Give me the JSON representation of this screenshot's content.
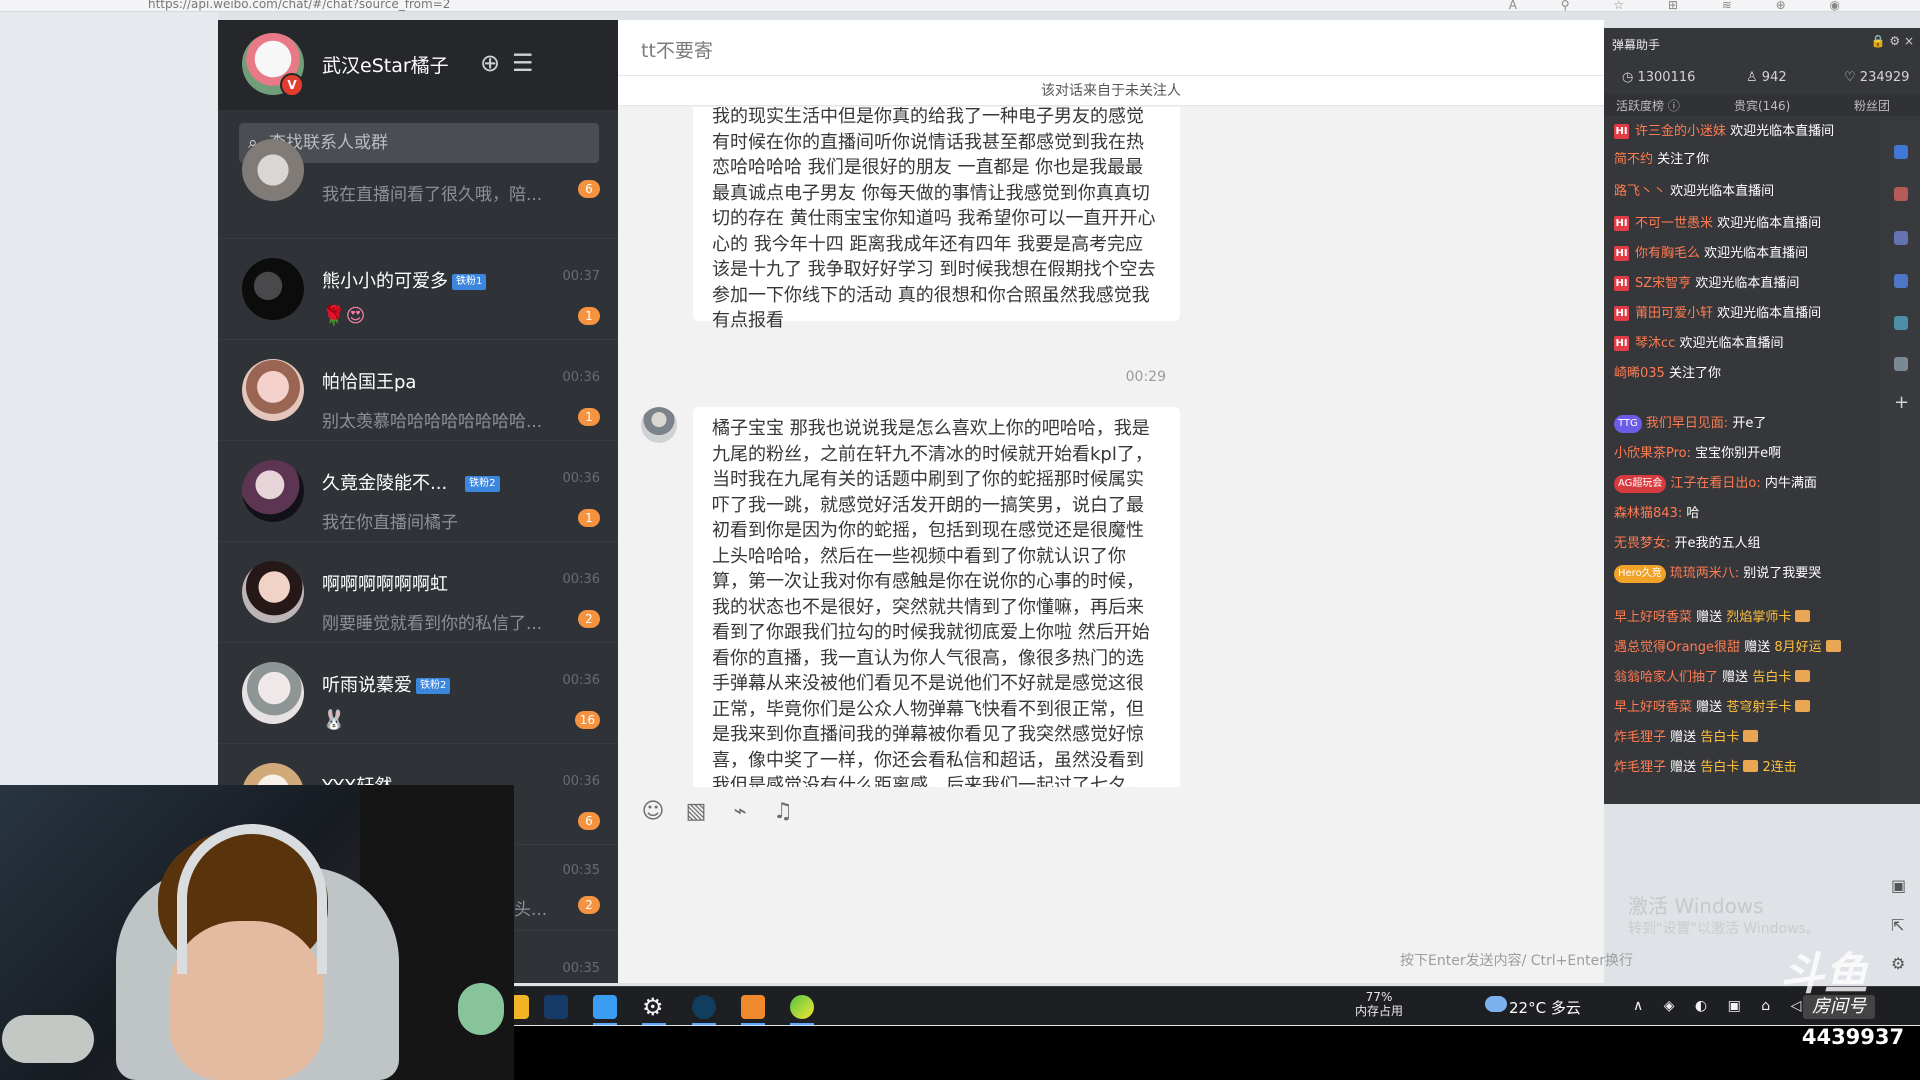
{
  "browser": {
    "url": "https://api.weibo.com/chat/#/chat?source_from=2"
  },
  "sidebar": {
    "username": "武汉eStar橘子",
    "search_placeholder": "查找联系人或群",
    "contacts": [
      {
        "name": "",
        "time": "",
        "message": "我在直播间看了很久哦，陪...",
        "badge": "6",
        "tag": "",
        "emoji": ""
      },
      {
        "name": "熊小小的可爱多",
        "time": "00:37",
        "message": "",
        "badge": "1",
        "tag": "铁粉1",
        "emoji": "🌹😍"
      },
      {
        "name": "帕恰国王pa",
        "time": "00:36",
        "message": "别太羡慕哈哈哈哈哈哈哈哈...",
        "badge": "1",
        "tag": "",
        "emoji": ""
      },
      {
        "name": "久竟金陵能不...",
        "time": "00:36",
        "message": "我在你直播间橘子",
        "badge": "1",
        "tag": "铁粉2",
        "emoji": ""
      },
      {
        "name": "啊啊啊啊啊啊虹",
        "time": "00:36",
        "message": "刚要睡觉就看到你的私信了...",
        "badge": "2",
        "tag": "",
        "emoji": ""
      },
      {
        "name": "听雨说蓁爱",
        "time": "00:36",
        "message": "",
        "badge": "16",
        "tag": "铁粉2",
        "emoji": "🐰"
      },
      {
        "name": "YYX轩然",
        "time": "00:36",
        "message": "",
        "badge": "6",
        "tag": "",
        "emoji": ""
      },
      {
        "name": "",
        "time": "00:35",
        "message": "头...",
        "badge": "2",
        "tag": "",
        "emoji": ""
      },
      {
        "name": "",
        "time": "00:35",
        "message": "",
        "badge": "",
        "tag": "",
        "emoji": ""
      }
    ]
  },
  "chat": {
    "title": "tt不要寄",
    "notice": "该对话来自于未关注人",
    "timestamp": "00:29",
    "message1": "我的现实生活中但是你真的给我了一种电子男友的感觉 有时候在你的直播间听你说情话我甚至都感觉到我在热恋哈哈哈哈 我们是很好的朋友 一直都是 你也是我最最最真诚点电子男友 你每天做的事情让我感觉到你真真切切的存在 黄仕雨宝宝你知道吗 我希望你可以一直开开心心的 我今年十四 距离我成年还有四年 我要是高考完应该是十九了 我争取好好学习 到时候我想在假期找个空去参加一下你线下的活动 真的很想和你合照虽然我感觉我有点报看",
    "message2": "橘子宝宝 那我也说说我是怎么喜欢上你的吧哈哈，我是九尾的粉丝，之前在轩九不清冰的时候就开始看kpl了，当时我在九尾有关的话题中刷到了你的蛇摇那时候属实吓了我一跳，就感觉好活发开朗的一搞笑男，说白了最初看到你是因为你的蛇摇，包括到现在感觉还是很魔性上头哈哈哈，然后在一些视频中看到了你就认识了你算，第一次让我对你有感触是你在说你的心事的时候，我的状态也不是很好，突然就共情到了你懂嘛，再后来看到了你跟我们拉勾的时候我就彻底爱上你啦 然后开始看你的直播，我一直认为你人气很高，像很多热门的选手弹幕从来没被他们看见不是说他们不好就是感觉这很正常，毕竟你们是公众人物弹幕飞快看不到很正常，但是我来到你直播间我的弹幕被你看见了我突然感觉好惊喜，像中奖了一样，你还会看私信和超话，虽然没看到我但是感觉没有什么距离感，后来我们一起过了七夕，你拿着贺卡和玫瑰花给我表白哈哈哈，突然get到了电子男友哈哈哈，感觉在被捧了爱着，然",
    "input_hint": "按下Enter发送内容/ Ctrl+Enter换行",
    "toolbar": {
      "emoji_icon": "smile-icon",
      "image_icon": "image-icon",
      "attach_icon": "paperclip-icon",
      "bell_icon": "bell-icon"
    }
  },
  "danmu": {
    "title": "弹幕助手",
    "stats": {
      "likes": "1300116",
      "users": "942",
      "fans": "234929"
    },
    "tabs": [
      "活跃度榜 ⓘ",
      "贵宾(146)",
      "粉丝团"
    ],
    "rows": [
      {
        "badge": "HI",
        "name": "许三金的小迷妹",
        "message": "欢迎光临本直播间",
        "gift": "",
        "gift_extra": ""
      },
      {
        "badge": "",
        "name": "简不约",
        "message": "关注了你",
        "gift": "",
        "gift_extra": ""
      },
      {
        "badge": "",
        "name": "路飞丶丶",
        "message": "欢迎光临本直播间",
        "gift": "",
        "gift_extra": ""
      },
      {
        "badge": "HI",
        "name": "不可一世愚米",
        "message": "欢迎光临本直播间",
        "gift": "",
        "gift_extra": ""
      },
      {
        "badge": "HI",
        "name": "你有胸毛么",
        "message": "欢迎光临本直播间",
        "gift": "",
        "gift_extra": ""
      },
      {
        "badge": "HI",
        "name": "SZ宋智亨",
        "message": "欢迎光临本直播间",
        "gift": "",
        "gift_extra": ""
      },
      {
        "badge": "HI",
        "name": "莆田可爱小轩",
        "message": "欢迎光临本直播间",
        "gift": "",
        "gift_extra": ""
      },
      {
        "badge": "HI",
        "name": "琴沐cc",
        "message": "欢迎光临本直播间",
        "gift": "",
        "gift_extra": ""
      },
      {
        "badge": "",
        "name": "崎晞035",
        "message": "关注了你",
        "gift": "",
        "gift_extra": ""
      },
      {
        "badge": "TTG",
        "name": "我们早日见面:",
        "message": "开e了",
        "gift": "",
        "gift_extra": ""
      },
      {
        "badge": "",
        "name": "小欣果茶Pro:",
        "message": "宝宝你别开e啊",
        "gift": "",
        "gift_extra": ""
      },
      {
        "badge": "AG超玩会",
        "name": "江子在看日出o:",
        "message": "内牛满面",
        "gift": "",
        "gift_extra": ""
      },
      {
        "badge": "",
        "name": "森林猫843:",
        "message": "哈",
        "gift": "",
        "gift_extra": ""
      },
      {
        "badge": "",
        "name": "无畏梦女:",
        "message": "开e我的五人组",
        "gift": "",
        "gift_extra": ""
      },
      {
        "badge": "Hero久竞",
        "name": "琉琉两米八:",
        "message": "别说了我要哭",
        "gift": "",
        "gift_extra": ""
      },
      {
        "badge": "",
        "name": "早上好呀香菜",
        "message": "赠送",
        "gift": "烈焰掌师卡",
        "gift_extra": ""
      },
      {
        "badge": "",
        "name": "遇总觉得Orange很甜",
        "message": "赠送",
        "gift": "8月好运",
        "gift_extra": ""
      },
      {
        "badge": "",
        "name": "翁翁哈家人们抽了",
        "message": "赠送",
        "gift": "告白卡",
        "gift_extra": ""
      },
      {
        "badge": "",
        "name": "早上好呀香菜",
        "message": "赠送",
        "gift": "苍穹射手卡",
        "gift_extra": ""
      },
      {
        "badge": "",
        "name": "炸毛狸子",
        "message": "赠送",
        "gift": "告白卡",
        "gift_extra": ""
      },
      {
        "badge": "",
        "name": "炸毛狸子",
        "message": "赠送",
        "gift": "告白卡",
        "gift_extra": "2连击"
      }
    ]
  },
  "desktop": {
    "watermark_title": "激活 Windows",
    "watermark_sub": "转到\"设置\"以激活 Windows。",
    "memory_percent": "77%",
    "memory_label": "内存占用",
    "weather": "22°C  多云",
    "tray": "∧ ◈ ◐ ▣ ⌂ ◁ 中",
    "stream_logo": "斗鱼",
    "room_label": "房间号",
    "room_number": "4439937"
  }
}
